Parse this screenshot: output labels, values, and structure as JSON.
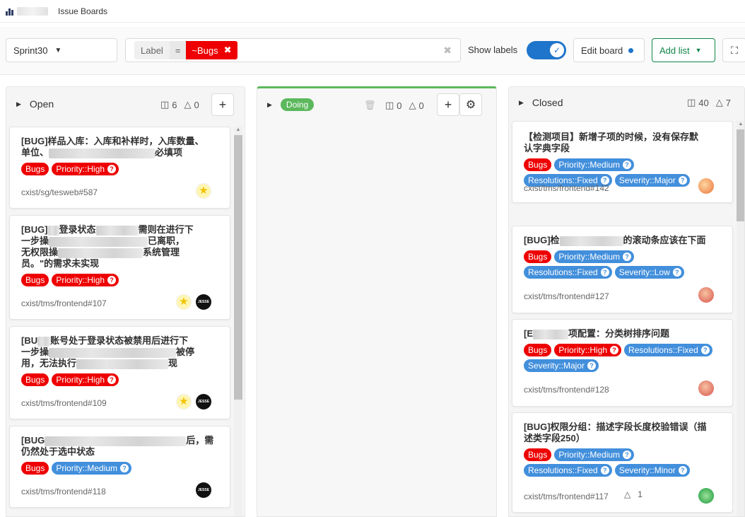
{
  "header": {
    "breadcrumb": "Issue Boards"
  },
  "filters": {
    "milestone": "Sprint30",
    "token_key": "Label",
    "token_op": "=",
    "token_value": "~Bugs",
    "show_labels": "Show labels",
    "edit_board": "Edit board",
    "add_list": "Add list"
  },
  "lists": {
    "open": {
      "title": "Open",
      "issues": "6",
      "weight": "0"
    },
    "doing": {
      "title": "Doing",
      "issues": "0",
      "weight": "0"
    },
    "closed": {
      "title": "Closed",
      "issues": "40",
      "weight": "7"
    }
  },
  "open_cards": [
    {
      "t1": "[BUG]样品入库：入库和补样时，入库数量、",
      "t2a": "单位、",
      "t2b": "必填项",
      "labels": [
        "Bugs",
        "Priority::High"
      ],
      "ref": "cxist/sg/tesweb#587"
    },
    {
      "t1a": "[BUG]",
      "t1b": "登录状态",
      "t1c": "需则在进行下",
      "t2a": "一步操",
      "t2b": "已离职，",
      "t3a": "无权限操",
      "t3b": "系统管理",
      "t4": "员。\"的需求未实现",
      "labels": [
        "Bugs",
        "Priority::High"
      ],
      "ref": "cxist/tms/frontend#107"
    },
    {
      "t1a": "[BU",
      "t1b": "账号处于登录状态被禁用后进行下",
      "t2a": "一步操",
      "t2b": "被停",
      "t3a": "用，无法执行",
      "t3b": "现",
      "labels": [
        "Bugs",
        "Priority::High"
      ],
      "ref": "cxist/tms/frontend#109"
    },
    {
      "t1a": "[BUG",
      "t1b": "后，需",
      "t2": "仍然处于选中状态",
      "labels": [
        "Bugs",
        "Priority::Medium"
      ],
      "ref": "cxist/tms/frontend#118"
    }
  ],
  "closed_cards": [
    {
      "t1": "【检测项目】新增子项的时候，没有保存默",
      "t2": "认字典字段",
      "labels": [
        "Bugs",
        "Priority::Medium",
        "Resolutions::Fixed",
        "Severity::Major"
      ],
      "ref": "cxist/tms/frontend#142"
    },
    {
      "t1a": "[BUG]检",
      "t1b": "的滚动条应该在下面",
      "labels": [
        "Bugs",
        "Priority::Medium",
        "Resolutions::Fixed",
        "Severity::Low"
      ],
      "ref": "cxist/tms/frontend#127"
    },
    {
      "t1a": "[E",
      "t1b": "项配置：分类树排序问题",
      "labels": [
        "Bugs",
        "Priority::High",
        "Resolutions::Fixed",
        "Severity::Major"
      ],
      "ref": "cxist/tms/frontend#128"
    },
    {
      "t1": "[BUG]权限分组：描述字段长度校验错误（描",
      "t2": "述类字段250）",
      "labels": [
        "Bugs",
        "Priority::Medium",
        "Resolutions::Fixed",
        "Severity::Minor"
      ],
      "ref": "cxist/tms/frontend#117",
      "weight": "1"
    }
  ],
  "colors": {
    "bugs": "#ee0000",
    "priority_high": "#ee0000",
    "scoped_blue": "#428fdc",
    "doing": "#5cb85c",
    "toggle": "#1f75cb"
  }
}
